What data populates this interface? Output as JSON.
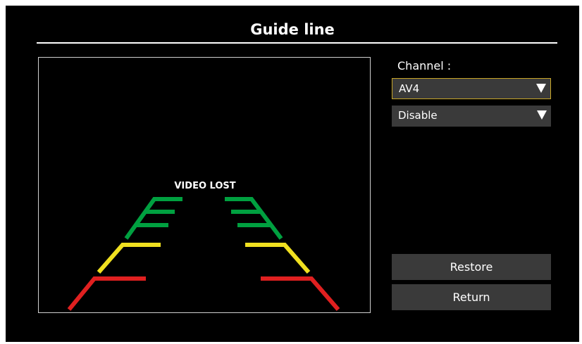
{
  "header": {
    "title": "Guide line"
  },
  "preview": {
    "status_text": "VIDEO LOST"
  },
  "guide_colors": {
    "near": "#e02020",
    "mid": "#f0e020",
    "far": "#00a040"
  },
  "settings": {
    "channel_label": "Channel :",
    "channel_value": "AV4",
    "mode_value": "Disable"
  },
  "buttons": {
    "restore": "Restore",
    "return": "Return"
  },
  "colors": {
    "background": "#000000",
    "control": "#3a3a3a",
    "focus": "#c8a628"
  }
}
